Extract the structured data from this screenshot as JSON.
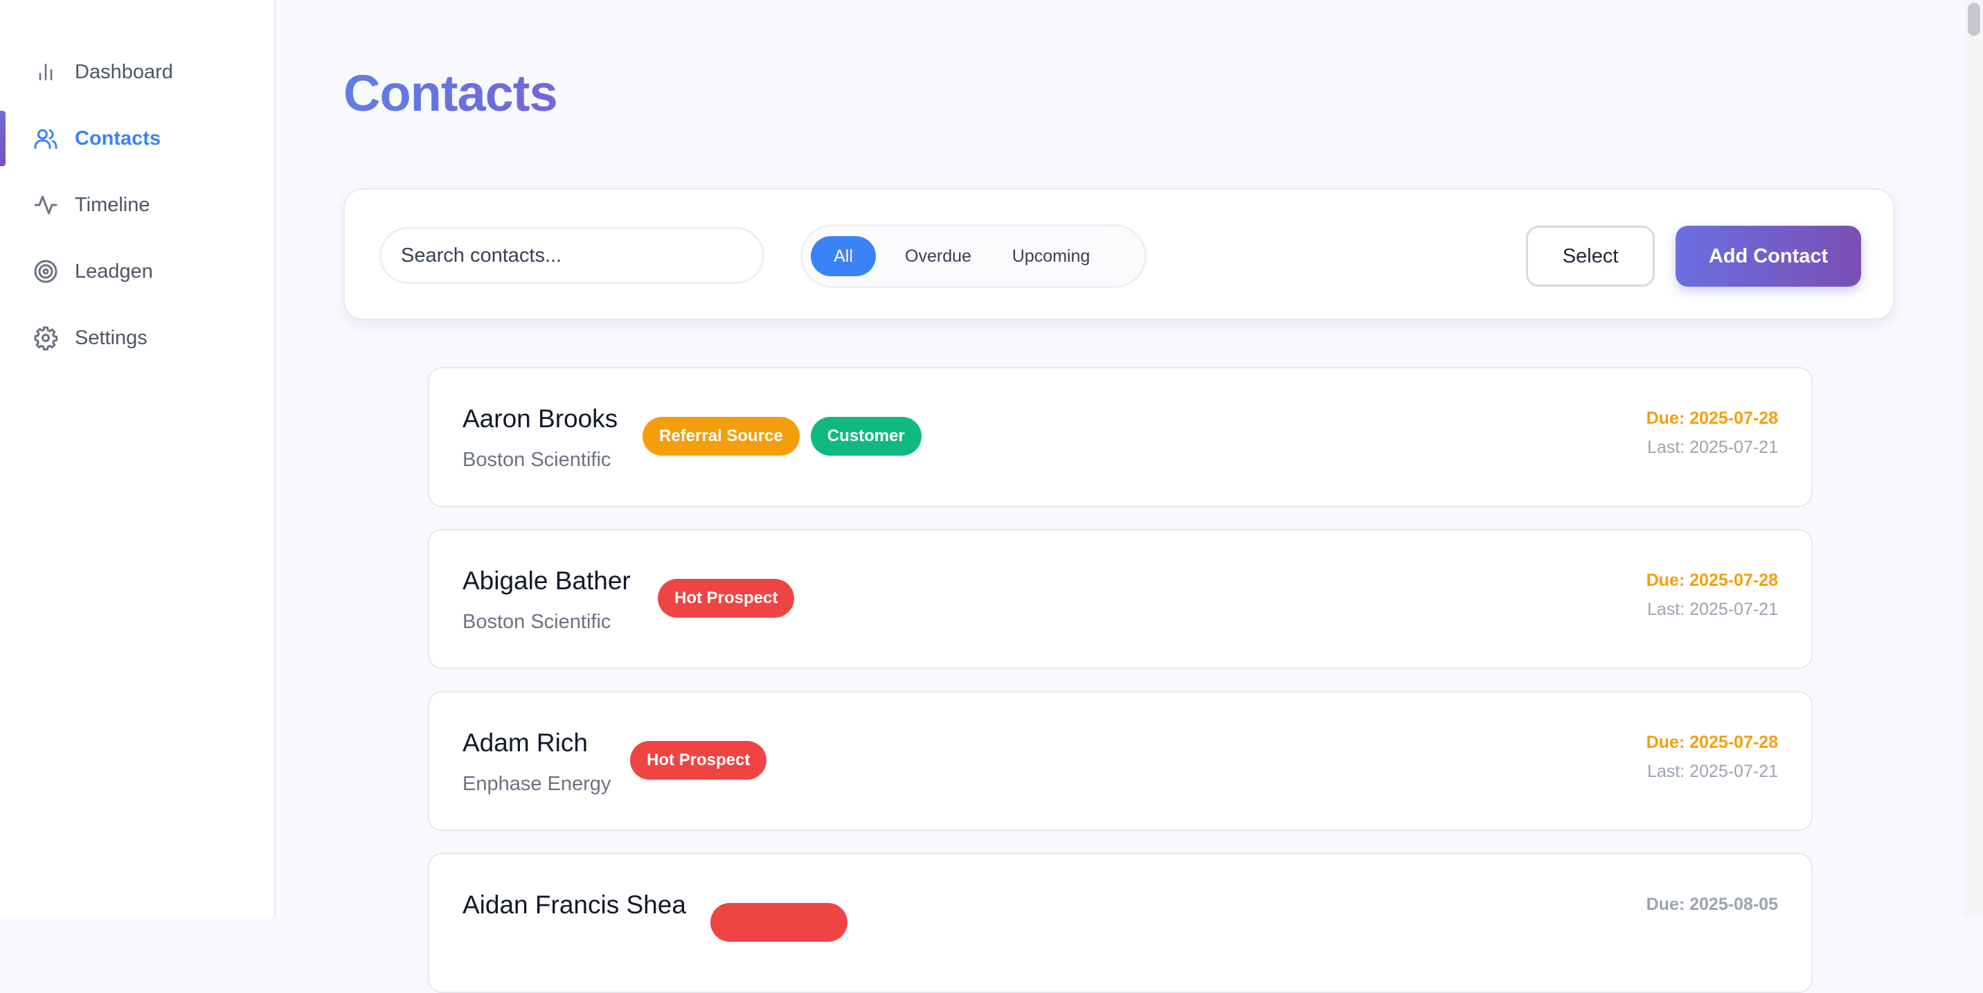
{
  "sidebar": {
    "items": [
      {
        "label": "Dashboard",
        "icon": "bar-chart-icon"
      },
      {
        "label": "Contacts",
        "icon": "users-icon",
        "active": true
      },
      {
        "label": "Timeline",
        "icon": "activity-icon"
      },
      {
        "label": "Leadgen",
        "icon": "target-icon"
      },
      {
        "label": "Settings",
        "icon": "gear-icon"
      }
    ]
  },
  "page": {
    "title": "Contacts"
  },
  "toolbar": {
    "search_placeholder": "Search contacts...",
    "search_value": "",
    "filters": [
      {
        "label": "All",
        "active": true
      },
      {
        "label": "Overdue"
      },
      {
        "label": "Upcoming"
      }
    ],
    "select_label": "Select",
    "add_label": "Add Contact"
  },
  "contacts": [
    {
      "name": "Aaron Brooks",
      "company": "Boston Scientific",
      "tags": [
        "Referral Source",
        "Customer"
      ],
      "due": "Due: 2025-07-28",
      "last": "Last: 2025-07-21"
    },
    {
      "name": "Abigale Bather",
      "company": "Boston Scientific",
      "tags": [
        "Hot Prospect"
      ],
      "due": "Due: 2025-07-28",
      "last": "Last: 2025-07-21"
    },
    {
      "name": "Adam Rich",
      "company": "Enphase Energy",
      "tags": [
        "Hot Prospect"
      ],
      "due": "Due: 2025-07-28",
      "last": "Last: 2025-07-21"
    },
    {
      "name": "Aidan Francis Shea",
      "company": "",
      "tags": [
        ""
      ],
      "due": "Due: 2025-08-05",
      "last": ""
    }
  ],
  "colors": {
    "accent": "#3b82f6",
    "brand_gradient_start": "#6a6fe0",
    "brand_gradient_end": "#7a4fb5",
    "due_soon": "#f59e0b",
    "tag_referral": "#f59e0b",
    "tag_customer": "#10b981",
    "tag_hot": "#ef4444"
  }
}
